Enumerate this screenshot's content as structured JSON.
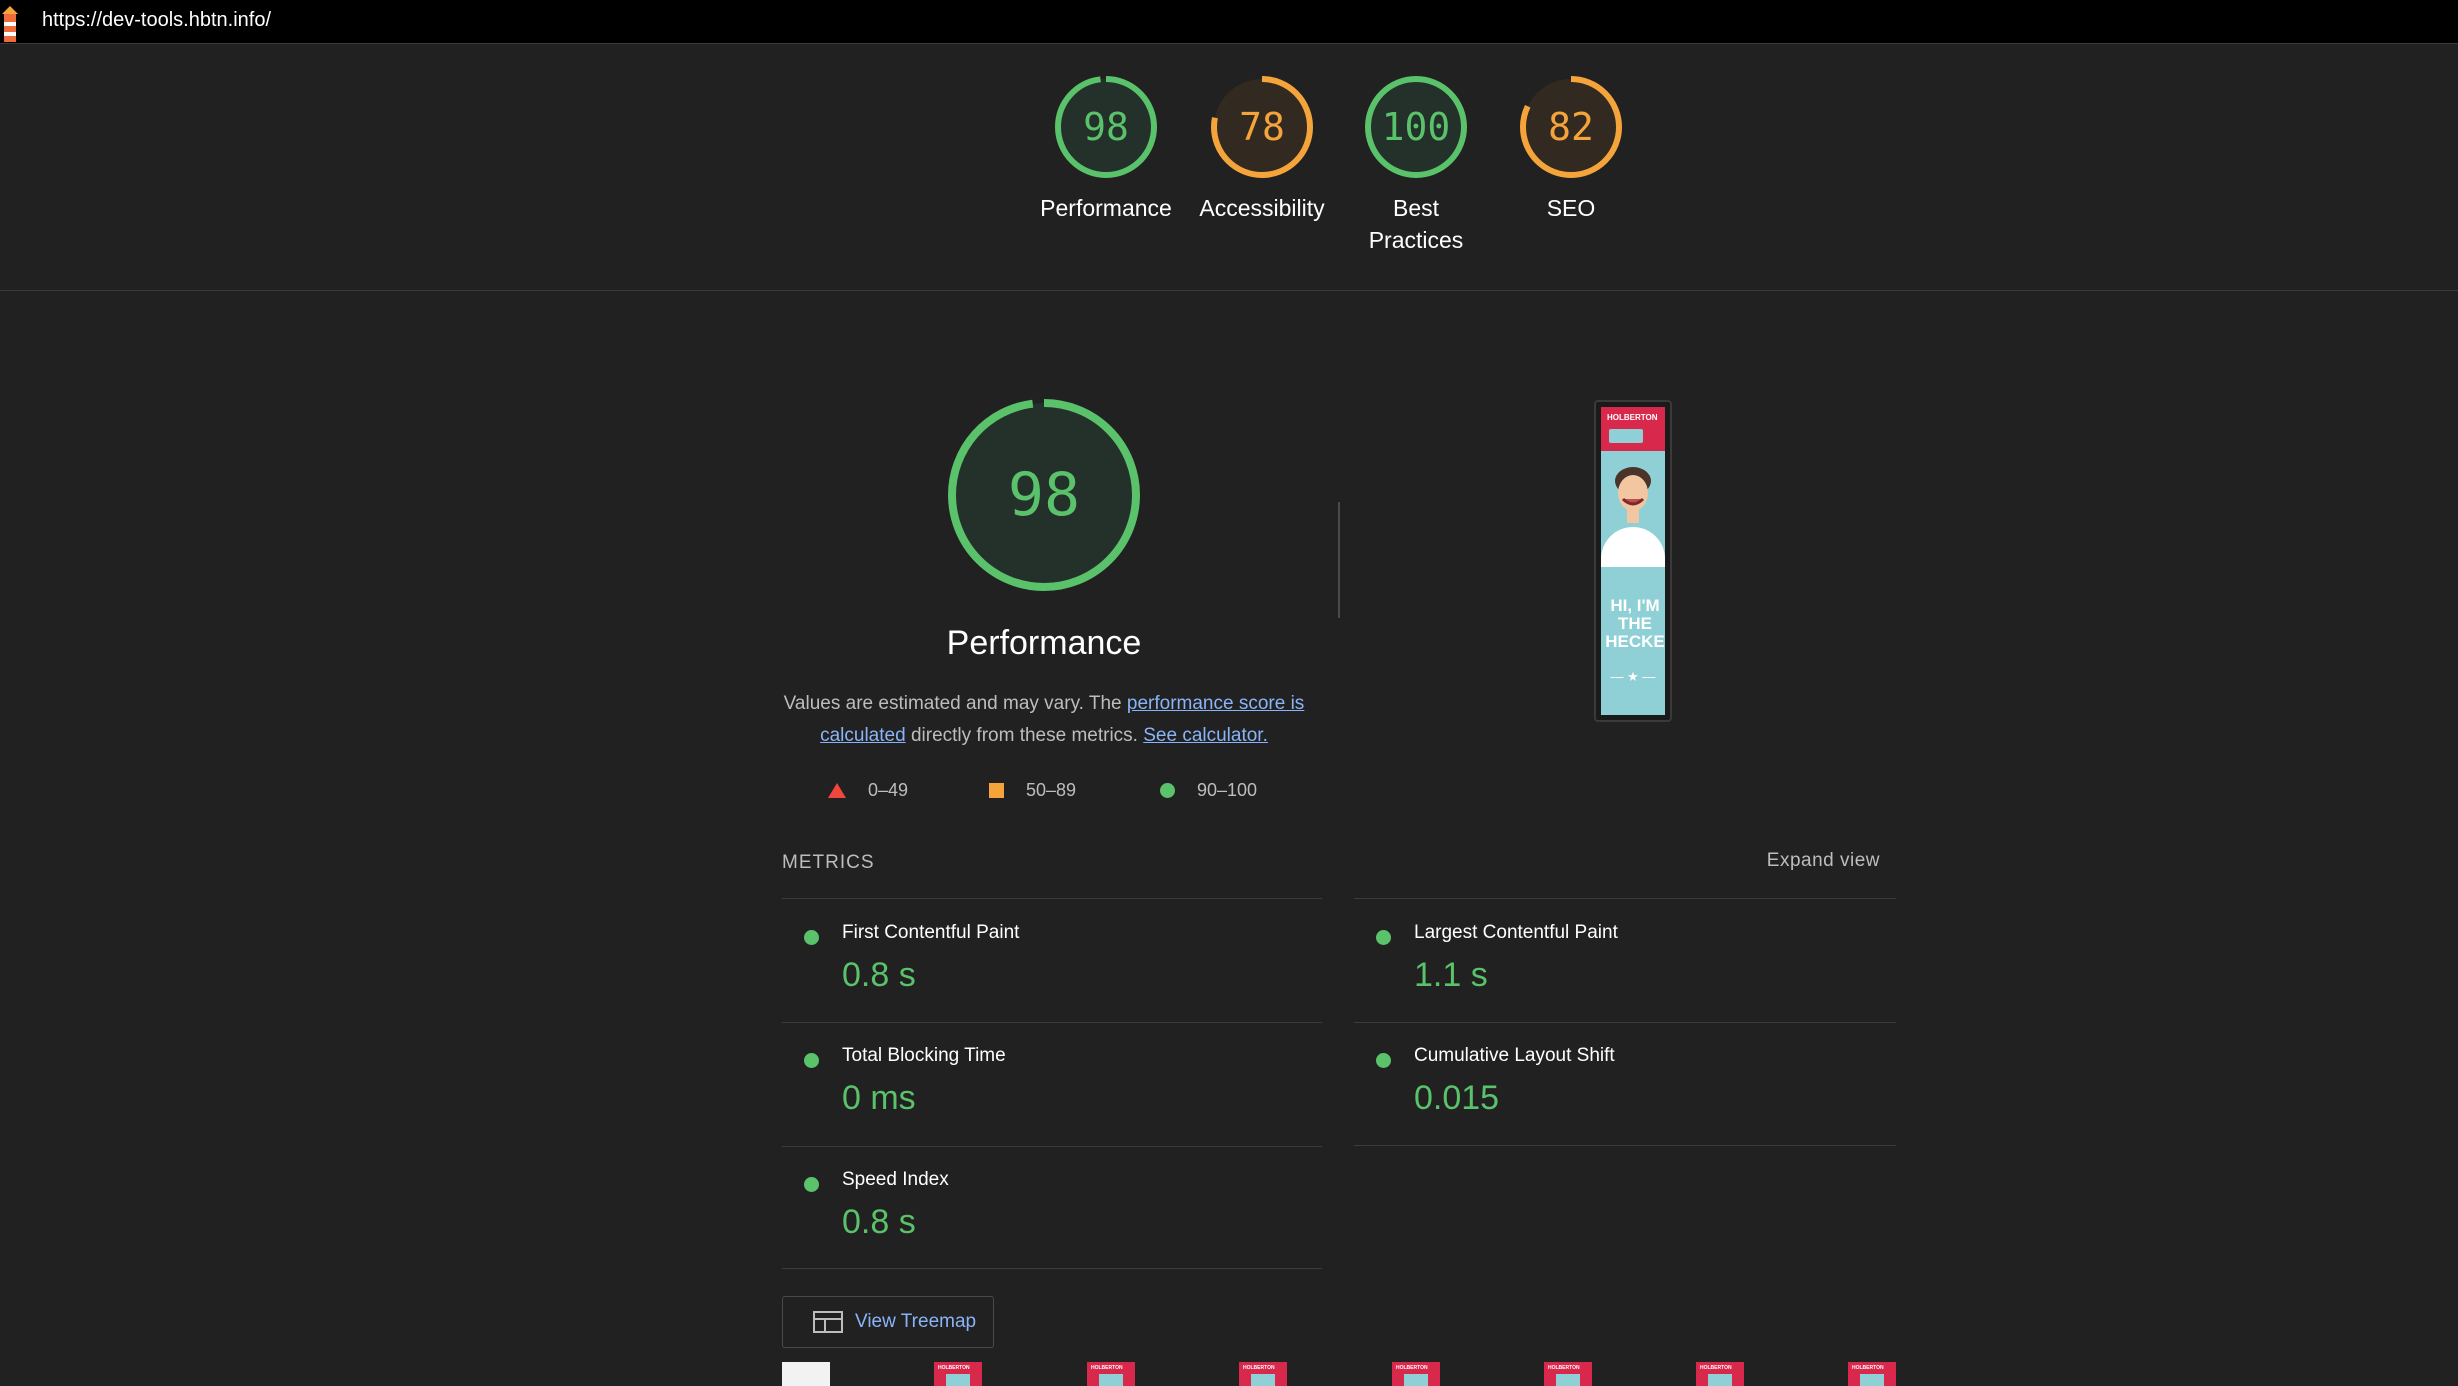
{
  "url_bar": {
    "url": "https://dev-tools.hbtn.info/"
  },
  "categories": [
    {
      "id": "performance",
      "score": "98",
      "label": "Performance",
      "color": "#5ac26a",
      "fraction": 0.98
    },
    {
      "id": "accessibility",
      "score": "78",
      "label": "Accessibility",
      "color": "#f5a43b",
      "fraction": 0.78
    },
    {
      "id": "best-practices",
      "score": "100",
      "label": "Best Practices",
      "color": "#5ac26a",
      "fraction": 1.0
    },
    {
      "id": "seo",
      "score": "82",
      "label": "SEO",
      "color": "#f5a43b",
      "fraction": 0.82
    }
  ],
  "performance": {
    "score": "98",
    "fraction": 0.98,
    "title": "Performance",
    "desc_prefix": "Values are estimated and may vary. The ",
    "desc_link": "performance score is calculated",
    "desc_middle": " directly from these metrics. ",
    "desc_link2": "See calculator."
  },
  "legend": [
    {
      "shape": "triangle",
      "range": "0–49",
      "color": "#f0473c"
    },
    {
      "shape": "square",
      "range": "50–89",
      "color": "#f5a43b"
    },
    {
      "shape": "circle",
      "range": "90–100",
      "color": "#5ac26a"
    }
  ],
  "screenshot": {
    "brand": "HOLBERTON",
    "headline": "HI, I'M THE HECKE",
    "star": "— ★ —"
  },
  "metrics": {
    "label": "METRICS",
    "expand": "Expand view",
    "items": [
      {
        "name": "First Contentful Paint",
        "value": "0.8 s"
      },
      {
        "name": "Largest Contentful Paint",
        "value": "1.1 s"
      },
      {
        "name": "Total Blocking Time",
        "value": "0 ms"
      },
      {
        "name": "Cumulative Layout Shift",
        "value": "0.015"
      },
      {
        "name": "Speed Index",
        "value": "0.8 s"
      }
    ]
  },
  "treemap": {
    "label": "View Treemap",
    "icon": "treemap-icon"
  },
  "filmstrip": {
    "brand": "HOLBERTON"
  },
  "colors": {
    "pass": "#5ac26a",
    "average": "#f5a43b",
    "fail": "#f0473c",
    "link": "#8ab4f8"
  }
}
